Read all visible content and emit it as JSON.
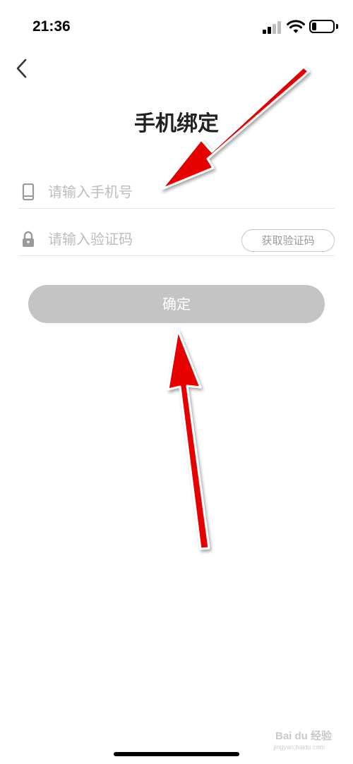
{
  "status_bar": {
    "time": "21:36",
    "signal_icon": "cellular-signal-icon",
    "wifi_icon": "wifi-icon",
    "battery_icon": "battery-icon",
    "battery_level": 0.2
  },
  "nav": {
    "back_icon": "chevron-left-icon"
  },
  "page": {
    "title": "手机绑定"
  },
  "form": {
    "phone": {
      "icon": "phone-icon",
      "placeholder": "请输入手机号",
      "value": ""
    },
    "code": {
      "icon": "lock-icon",
      "placeholder": "请输入验证码",
      "value": "",
      "send_button_label": "获取验证码"
    },
    "confirm_label": "确定"
  },
  "colors": {
    "confirm_button": "#c4c4c4",
    "annotation_arrow": "#e60000",
    "placeholder": "#bdbdbd"
  },
  "watermark": {
    "text": "Bai du 经验",
    "sub": "jingyan.baidu.com"
  }
}
